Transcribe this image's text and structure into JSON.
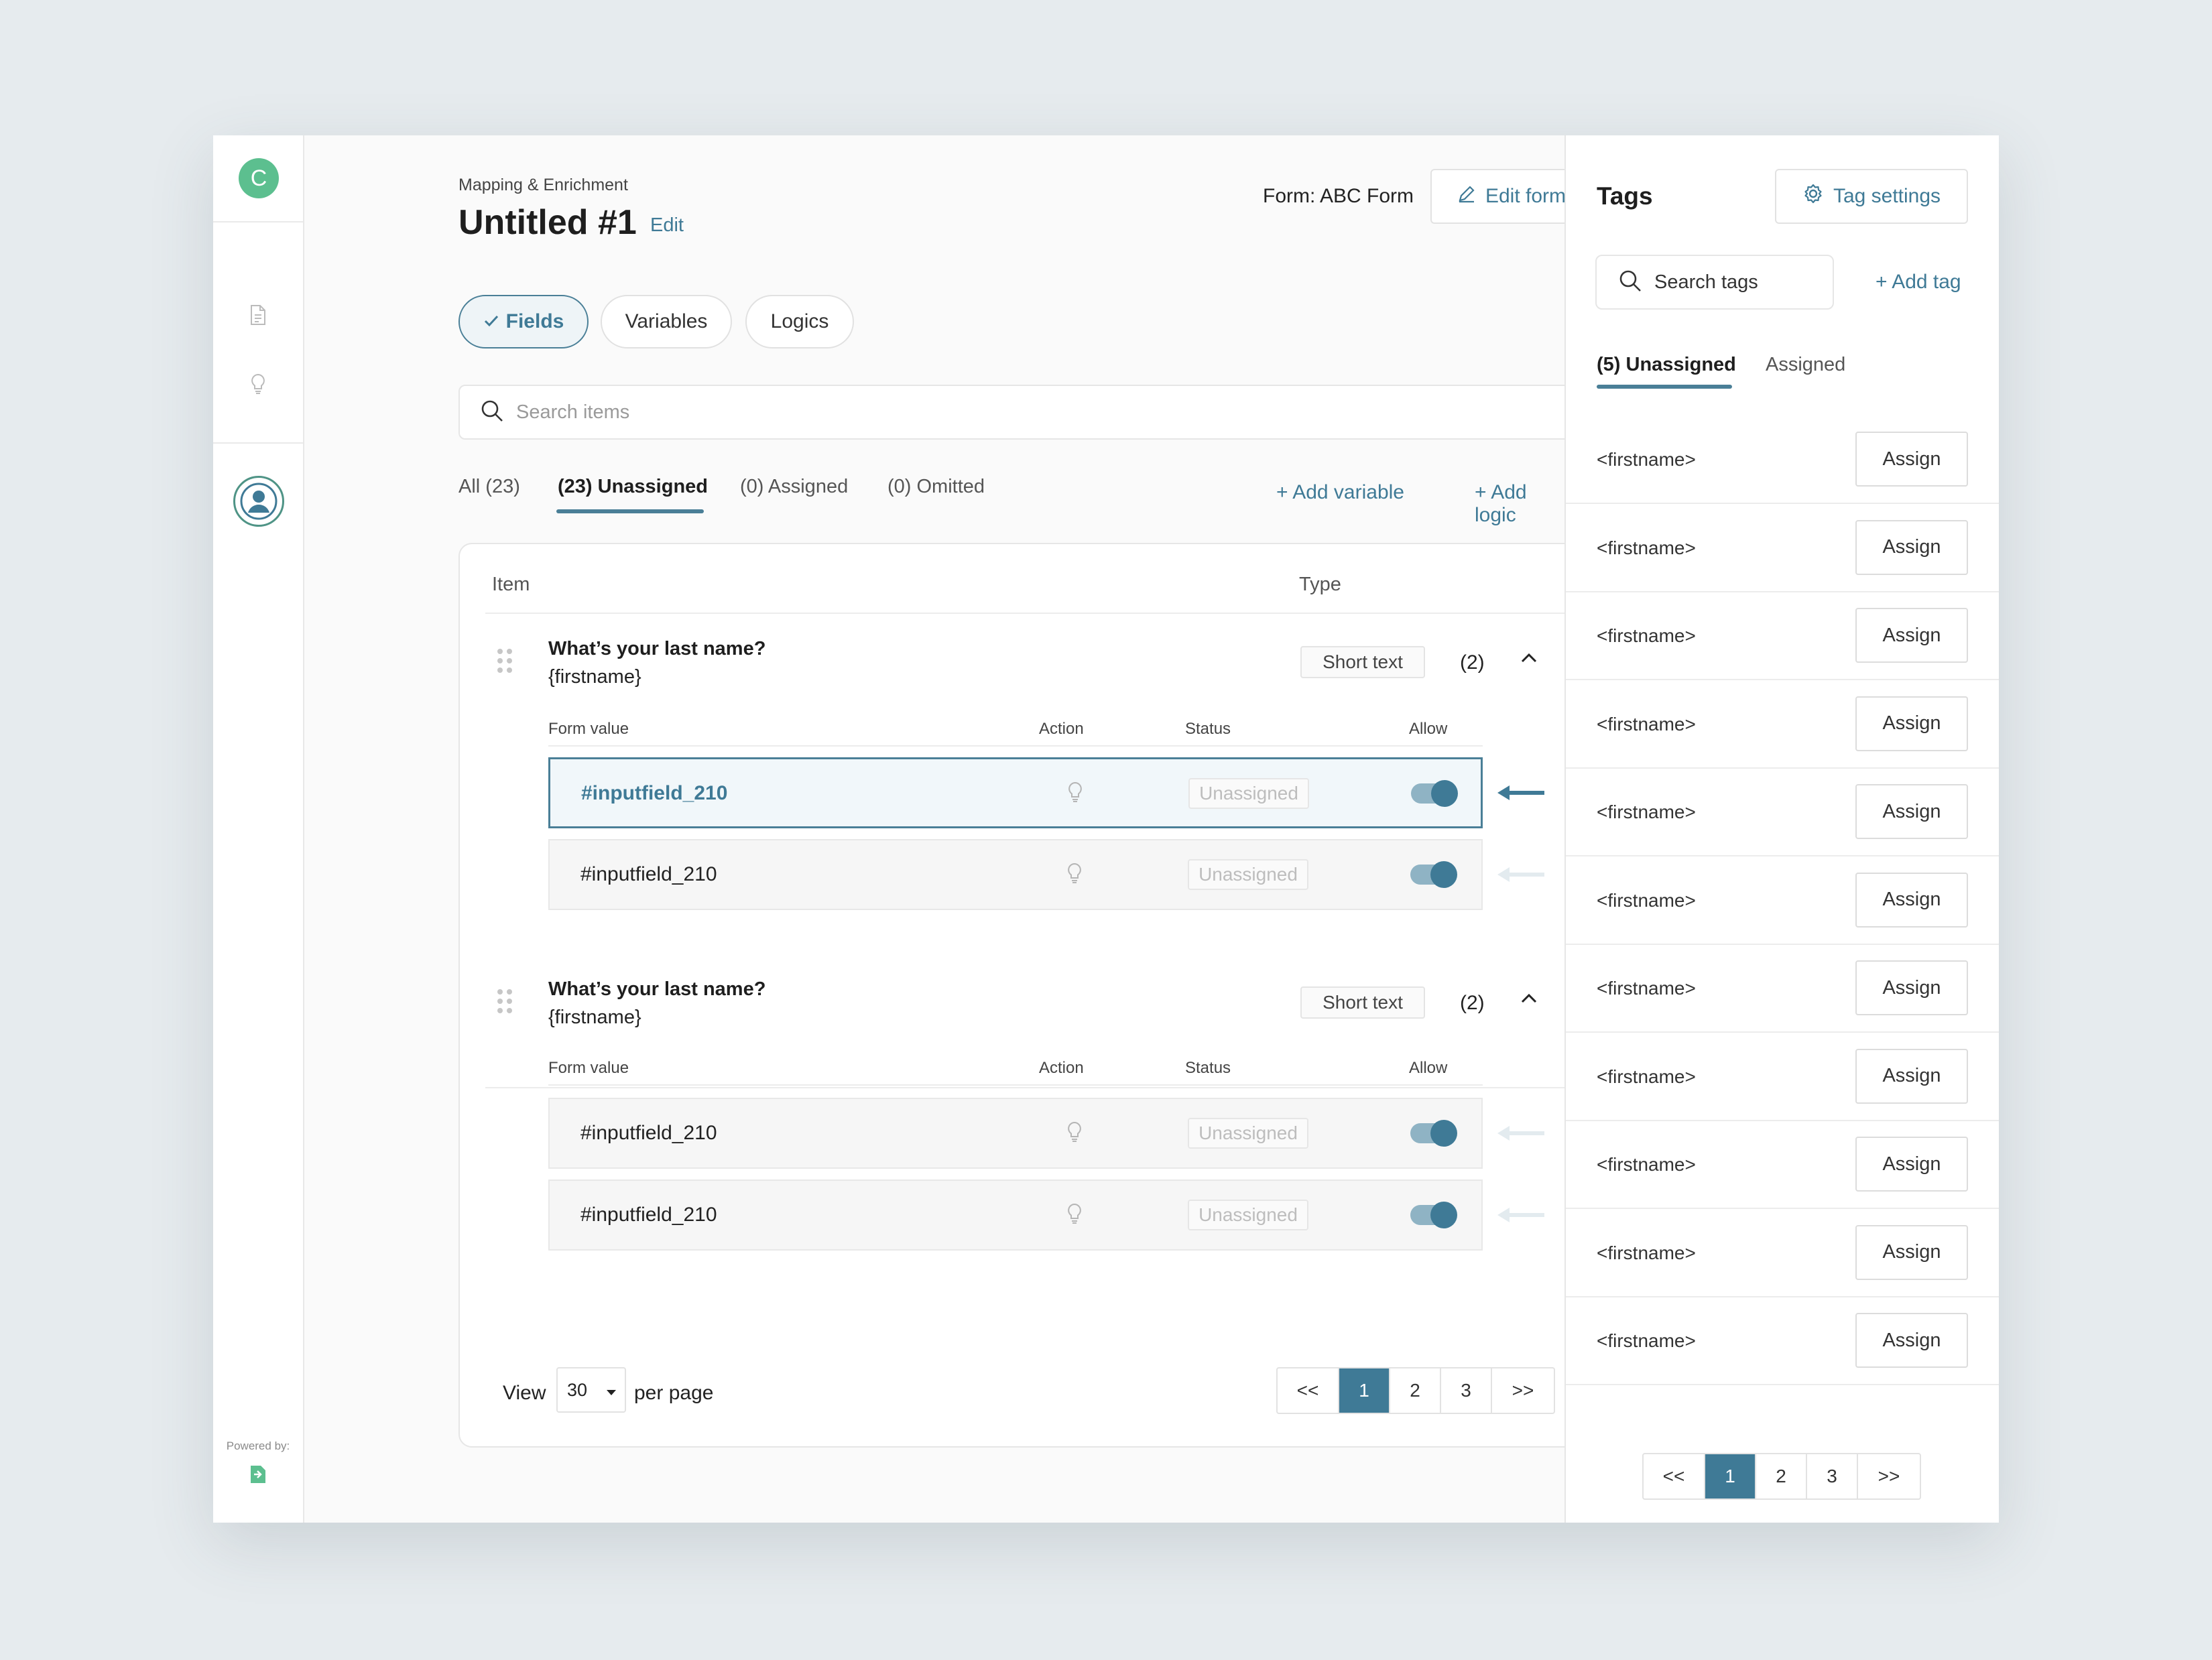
{
  "sidebar": {
    "logo_letter": "C",
    "powered_by": "Powered by:"
  },
  "header": {
    "breadcrumb": "Mapping & Enrichment",
    "title": "Untitled #1",
    "title_edit": "Edit",
    "form_label": "Form: ABC Form",
    "edit_form": "Edit form"
  },
  "segments": [
    {
      "label": "Fields",
      "active": true
    },
    {
      "label": "Variables",
      "active": false
    },
    {
      "label": "Logics",
      "active": false
    }
  ],
  "search": {
    "placeholder": "Search items"
  },
  "filter_tabs": [
    {
      "label": "All (23)"
    },
    {
      "label": "(23) Unassigned",
      "active": true
    },
    {
      "label": "(0) Assigned"
    },
    {
      "label": "(0) Omitted"
    }
  ],
  "actions": {
    "add_variable": "+ Add variable",
    "add_logic": "+ Add logic"
  },
  "table": {
    "col_item": "Item",
    "col_type": "Type",
    "groups": [
      {
        "title": "What’s your last name?",
        "subtitle": "{firstname}",
        "type": "Short text",
        "count": "(2)",
        "sub_headers": {
          "form_value": "Form value",
          "action": "Action",
          "status": "Status",
          "allow": "Allow"
        },
        "rows": [
          {
            "value": "#inputfield_210",
            "status": "Unassigned",
            "selected": true
          },
          {
            "value": "#inputfield_210",
            "status": "Unassigned",
            "selected": false
          }
        ]
      },
      {
        "title": "What’s your last name?",
        "subtitle": "{firstname}",
        "type": "Short text",
        "count": "(2)",
        "sub_headers": {
          "form_value": "Form value",
          "action": "Action",
          "status": "Status",
          "allow": "Allow"
        },
        "rows": [
          {
            "value": "#inputfield_210",
            "status": "Unassigned",
            "selected": false
          },
          {
            "value": "#inputfield_210",
            "status": "Unassigned",
            "selected": false
          }
        ]
      }
    ]
  },
  "pagination": {
    "view_label": "View",
    "per_page_value": "30",
    "per_page_label": "per page",
    "prev": "<<",
    "pages": [
      "1",
      "2",
      "3"
    ],
    "current": "1",
    "next": ">>"
  },
  "tags_panel": {
    "title": "Tags",
    "settings": "Tag settings",
    "search_placeholder": "Search tags",
    "add_tag": "+ Add tag",
    "tab_unassigned": "(5) Unassigned",
    "tab_assigned": "Assigned",
    "items": [
      {
        "name": "<firstname>",
        "action": "Assign"
      },
      {
        "name": "<firstname>",
        "action": "Assign"
      },
      {
        "name": "<firstname>",
        "action": "Assign"
      },
      {
        "name": "<firstname>",
        "action": "Assign"
      },
      {
        "name": "<firstname>",
        "action": "Assign"
      },
      {
        "name": "<firstname>",
        "action": "Assign"
      },
      {
        "name": "<firstname>",
        "action": "Assign"
      },
      {
        "name": "<firstname>",
        "action": "Assign"
      },
      {
        "name": "<firstname>",
        "action": "Assign"
      },
      {
        "name": "<firstname>",
        "action": "Assign"
      },
      {
        "name": "<firstname>",
        "action": "Assign"
      }
    ],
    "pagination": {
      "prev": "<<",
      "pages": [
        "1",
        "2",
        "3"
      ],
      "current": "1",
      "next": ">>"
    }
  },
  "colors": {
    "accent": "#3f7a96",
    "brand": "#5cbf8f"
  },
  "icons": [
    "document-icon",
    "lightbulb-icon",
    "user-avatar-icon",
    "search-icon",
    "pencil-icon",
    "gear-icon",
    "check-icon",
    "chevron-up-icon",
    "drag-handle-icon",
    "arrow-left-icon",
    "caret-down-icon"
  ]
}
